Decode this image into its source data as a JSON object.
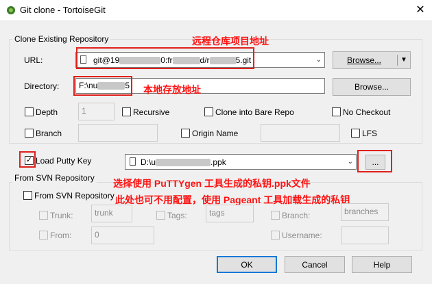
{
  "window": {
    "title": "Git clone - TortoiseGit",
    "close_glyph": "✕"
  },
  "clone_group": {
    "title": "Clone Existing Repository",
    "url_label": "URL:",
    "url_segments": [
      "git@19",
      "0:fr",
      "d/r",
      "5.git"
    ],
    "browse_label": "Browse...",
    "dropdown_glyph": "▼",
    "directory_label": "Directory:",
    "directory_segments": [
      "F:\\nu",
      "5"
    ],
    "browse2_label": "Browse...",
    "depth_label": "Depth",
    "depth_value": "1",
    "recursive_label": "Recursive",
    "bare_label": "Clone into Bare Repo",
    "no_checkout_label": "No Checkout",
    "branch_label": "Branch",
    "origin_label": "Origin Name",
    "lfs_label": "LFS"
  },
  "putty": {
    "label": "Load Putty Key",
    "checked": true,
    "key_segments": [
      "D:\\u",
      ".ppk"
    ],
    "browse_label": "..."
  },
  "svn_group": {
    "title": "From SVN Repository",
    "from_svn_label": "From SVN Repository",
    "trunk_label": "Trunk:",
    "trunk_value": "trunk",
    "tags_label": "Tags:",
    "tags_value": "tags",
    "branch_label": "Branch:",
    "branches_value": "branches",
    "from_label": "From:",
    "from_value": "0",
    "username_label": "Username:"
  },
  "buttons": {
    "ok": "OK",
    "cancel": "Cancel",
    "help": "Help"
  },
  "annotations": {
    "repo_url": "远程仓库项目地址",
    "local_path": "本地存放地址",
    "puttygen": "选择使用 PuTTYgen 工具生成的私钥.ppk文件",
    "pageant": "此处也可不用配置，使用 Pageant 工具加载生成的私钥"
  },
  "colors": {
    "annotation": "#e0201b",
    "accent": "#0078d7"
  }
}
